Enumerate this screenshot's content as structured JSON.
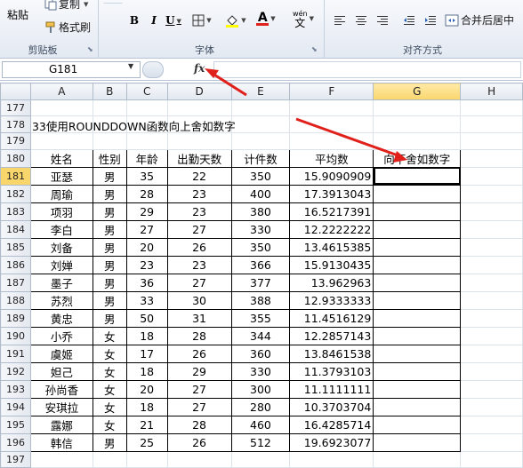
{
  "ribbon": {
    "paste_label": "粘贴",
    "copy_label": "复制",
    "format_painter_label": "格式刷",
    "clipboard_group": "剪贴板",
    "font_group": "字体",
    "align_group": "对齐方式",
    "merge_label": "合并后居中",
    "bold": "B",
    "italic": "I",
    "underline": "U",
    "font_color_glyph": "A",
    "phonetic_glyph": "wén",
    "phonetic_char": "文"
  },
  "formula_bar": {
    "name_box": "G181",
    "fx": "fx",
    "content": ""
  },
  "columns": [
    "A",
    "B",
    "C",
    "D",
    "E",
    "F",
    "G",
    "H"
  ],
  "title_row": {
    "row": "178",
    "text": "33使用ROUNDDOWN函数向上舍如数字"
  },
  "header_row": {
    "row": "180",
    "cells": [
      "姓名",
      "性别",
      "年龄",
      "出勤天数",
      "计件数",
      "平均数",
      "向下舍如数字"
    ]
  },
  "rows": [
    {
      "row": "181",
      "cells": [
        "亚瑟",
        "男",
        "35",
        "22",
        "350",
        "15.9090909",
        ""
      ]
    },
    {
      "row": "182",
      "cells": [
        "周瑜",
        "男",
        "28",
        "23",
        "400",
        "17.3913043",
        ""
      ]
    },
    {
      "row": "183",
      "cells": [
        "项羽",
        "男",
        "29",
        "23",
        "380",
        "16.5217391",
        ""
      ]
    },
    {
      "row": "184",
      "cells": [
        "李白",
        "男",
        "27",
        "27",
        "330",
        "12.2222222",
        ""
      ]
    },
    {
      "row": "185",
      "cells": [
        "刘备",
        "男",
        "20",
        "26",
        "350",
        "13.4615385",
        ""
      ]
    },
    {
      "row": "186",
      "cells": [
        "刘婵",
        "男",
        "23",
        "23",
        "366",
        "15.9130435",
        ""
      ]
    },
    {
      "row": "187",
      "cells": [
        "墨子",
        "男",
        "36",
        "27",
        "377",
        "13.962963",
        ""
      ]
    },
    {
      "row": "188",
      "cells": [
        "苏烈",
        "男",
        "33",
        "30",
        "388",
        "12.9333333",
        ""
      ]
    },
    {
      "row": "189",
      "cells": [
        "黄忠",
        "男",
        "50",
        "31",
        "355",
        "11.4516129",
        ""
      ]
    },
    {
      "row": "190",
      "cells": [
        "小乔",
        "女",
        "18",
        "28",
        "344",
        "12.2857143",
        ""
      ]
    },
    {
      "row": "191",
      "cells": [
        "虞姬",
        "女",
        "17",
        "26",
        "360",
        "13.8461538",
        ""
      ]
    },
    {
      "row": "192",
      "cells": [
        "妲己",
        "女",
        "18",
        "29",
        "330",
        "11.3793103",
        ""
      ]
    },
    {
      "row": "193",
      "cells": [
        "孙尚香",
        "女",
        "20",
        "27",
        "300",
        "11.1111111",
        ""
      ]
    },
    {
      "row": "194",
      "cells": [
        "安琪拉",
        "女",
        "18",
        "27",
        "280",
        "10.3703704",
        ""
      ]
    },
    {
      "row": "195",
      "cells": [
        "露娜",
        "女",
        "21",
        "28",
        "460",
        "16.4285714",
        ""
      ]
    },
    {
      "row": "196",
      "cells": [
        "韩信",
        "男",
        "25",
        "26",
        "512",
        "19.6923077",
        ""
      ]
    }
  ],
  "empty_rows": [
    "177",
    "179",
    "197"
  ],
  "colors": {
    "annotation_red": "#e0201b",
    "selection": "#f9d66c"
  }
}
